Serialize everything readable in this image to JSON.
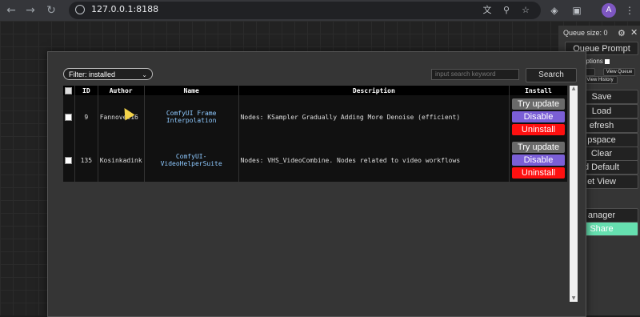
{
  "browser": {
    "url": "127.0.0.1:8188",
    "avatar_letter": "A",
    "icons": [
      "back-icon",
      "forward-icon",
      "reload-icon",
      "site-info-icon",
      "translate-icon",
      "zoom-icon",
      "bookmark-star-icon",
      "shield-extension-icon",
      "puzzle-extension-icon",
      "kebab-menu-icon"
    ]
  },
  "comfy_menu": {
    "queue_size": "Queue size: 0",
    "queue_prompt": "Queue Prompt",
    "extra_options": "options",
    "view_queue": "View Queue",
    "view_history": "View History",
    "buttons": [
      "Save",
      "Load",
      "Refresh",
      "Clipspace",
      "Clear",
      "Load Default",
      "Reset View"
    ],
    "visible_buttons": [
      "Save",
      "Load",
      "efresh",
      "pspace",
      "Clear",
      "d Default",
      "et View"
    ],
    "manager": "anager",
    "share": "Share"
  },
  "manager_dialog": {
    "filter": {
      "selected": "Filter: installed"
    },
    "search": {
      "placeholder": "input search keyword",
      "button": "Search"
    },
    "columns": [
      "",
      "ID",
      "Author",
      "Name",
      "Description",
      "Install"
    ],
    "rows": [
      {
        "id": "9",
        "author": "Fannovel16",
        "name": "ComfyUI Frame Interpolation",
        "description": "Nodes: KSampler Gradually Adding More Denoise (efficient)",
        "actions": [
          "Try update",
          "Disable",
          "Uninstall"
        ]
      },
      {
        "id": "135",
        "author": "Kosinkadink",
        "name": "ComfyUI-VideoHelperSuite",
        "description": "Nodes: VHS_VideoCombine. Nodes related to video workflows",
        "actions": [
          "Try update",
          "Disable",
          "Uninstall"
        ]
      }
    ]
  },
  "colors": {
    "disable_button": "#7b5fd6",
    "uninstall_button": "#ff1010",
    "share_button": "#66e0b0",
    "link_text": "#8ec9ff"
  }
}
